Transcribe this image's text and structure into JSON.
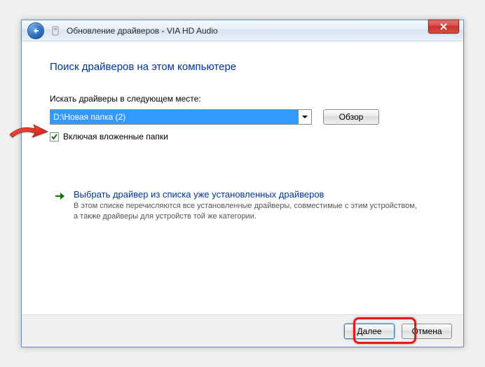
{
  "titlebar": {
    "title": "Обновление драйверов - VIA HD Audio"
  },
  "content": {
    "heading": "Поиск драйверов на этом компьютере",
    "path_label": "Искать драйверы в следующем месте:",
    "path_value": "D:\\Новая папка (2)",
    "browse_label": "Обзор",
    "checkbox_label": "Включая вложенные папки",
    "option": {
      "title": "Выбрать драйвер из списка уже установленных драйверов",
      "desc": "В этом списке перечисляются все установленные драйверы, совместимые с этим устройством, а также драйверы для устройств той же категории."
    }
  },
  "footer": {
    "next": "Далее",
    "cancel": "Отмена"
  }
}
